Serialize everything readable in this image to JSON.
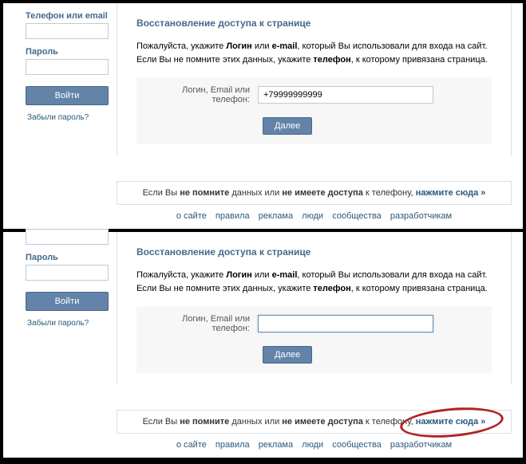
{
  "sidebar": {
    "login_label": "Телефон или email",
    "password_label": "Пароль",
    "login_button": "Войти",
    "forgot_link": "Забыли пароль?"
  },
  "restore": {
    "title": "Восстановление доступа к странице",
    "desc_prefix": "Пожалуйста, укажите ",
    "desc_login": "Логин",
    "desc_or": " или ",
    "desc_email": "e-mail",
    "desc_mid": ", который Вы использовали для входа на сайт. Если Вы не помните этих данных, укажите ",
    "desc_phone": "телефон",
    "desc_suffix": ", к которому привязана страница.",
    "input_label": "Логин, Email или телефон:",
    "input_value1": "+79999999999",
    "input_value2": "",
    "next_button": "Далее"
  },
  "help": {
    "prefix": "Если Вы ",
    "bold1": "не помните",
    "mid1": " данных или ",
    "bold2": "не имеете доступа",
    "mid2": " к телефону, ",
    "link": "нажмите сюда »"
  },
  "footer": {
    "items": [
      "о сайте",
      "правила",
      "реклама",
      "люди",
      "сообщества",
      "разработчикам"
    ]
  }
}
